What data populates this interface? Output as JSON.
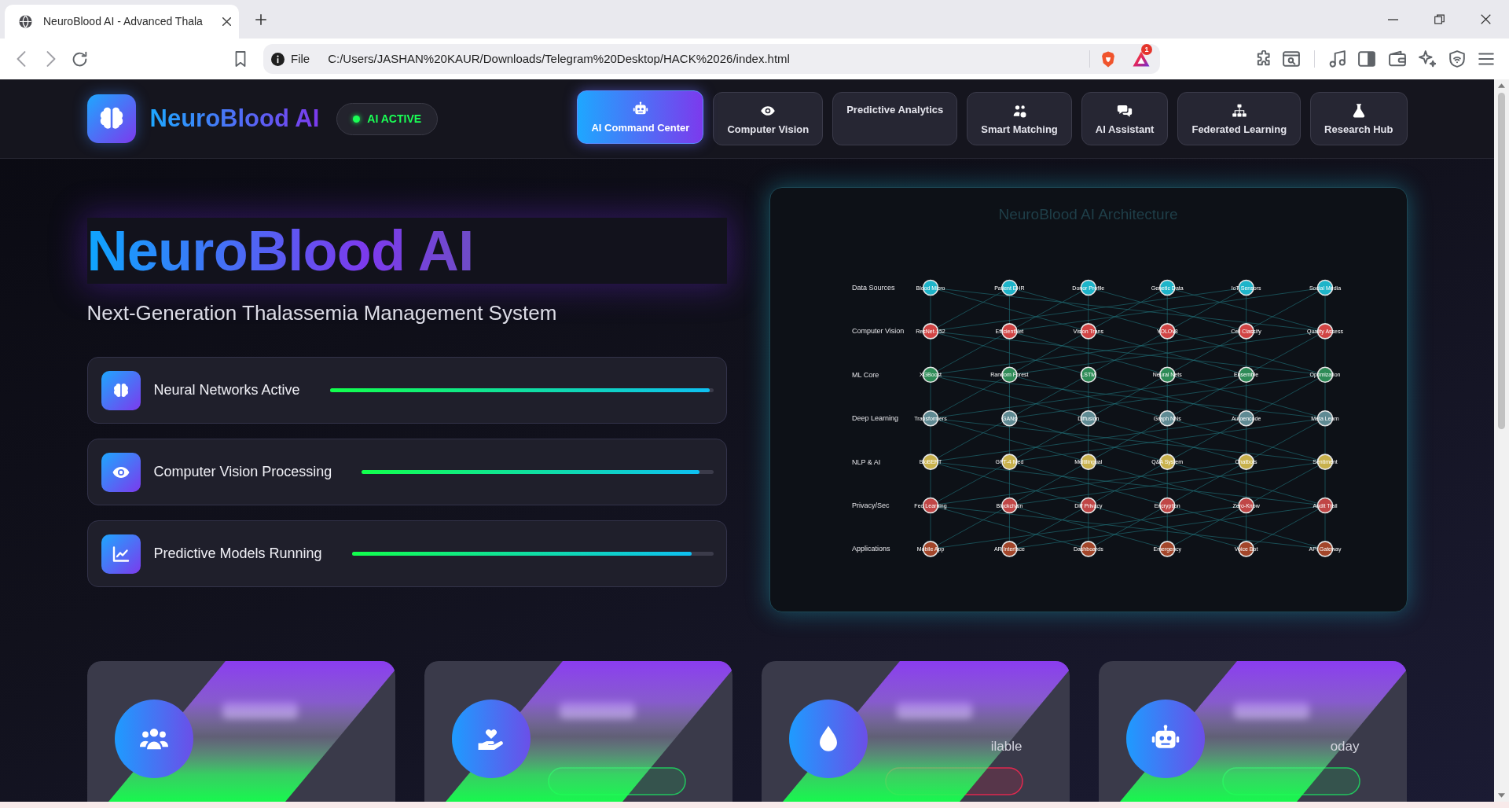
{
  "browser": {
    "tab_title": "NeuroBlood AI - Advanced Thala",
    "site_info": "File",
    "url": "C:/Users/JASHAN%20KAUR/Downloads/Telegram%20Desktop/HACK%2026/index.html",
    "rewards_badge": "1"
  },
  "header": {
    "brand": "NeuroBlood AI",
    "status": {
      "label": "AI ACTIVE",
      "on": true
    },
    "nav": [
      {
        "label": "AI Command Center",
        "kind": "icon_label",
        "selected": true
      },
      {
        "label": "Computer Vision",
        "kind": "icon_label",
        "selected": false
      },
      {
        "label": "Predictive Analytics",
        "kind": "label",
        "selected": false
      },
      {
        "label": "Smart Matching",
        "kind": "icon_label",
        "selected": false
      },
      {
        "label": "AI Assistant",
        "kind": "icon_label",
        "selected": false
      },
      {
        "label": "Federated Learning",
        "kind": "icon_label",
        "selected": false
      },
      {
        "label": "Research Hub",
        "kind": "icon_label",
        "selected": false
      }
    ]
  },
  "hero": {
    "title": "NeuroBlood AI",
    "subtitle": "Next-Generation Thalassemia Management System",
    "systems": [
      {
        "label": "Neural Networks Active",
        "level": 0.99
      },
      {
        "label": "Computer Vision Processing",
        "level": 0.96
      },
      {
        "label": "Predictive Models Running",
        "level": 0.94
      }
    ]
  },
  "architecture": {
    "title": "NeuroBlood AI Architecture",
    "layers": [
      {
        "label": "Data Sources",
        "color": "#1eb4c9",
        "nodes": [
          "Blood Micro",
          "Patient EHR",
          "Donor Profile",
          "Genetic Data",
          "IoT Sensors",
          "Social Media"
        ]
      },
      {
        "label": "Computer Vision",
        "color": "#d14444",
        "nodes": [
          "ResNet-152",
          "EfficientNet",
          "Vision Trans",
          "YOLOv8",
          "Cell Classify",
          "Quality Assess"
        ]
      },
      {
        "label": "ML Core",
        "color": "#2e8b57",
        "nodes": [
          "XGBoost",
          "Random Forest",
          "LSTM",
          "Neural Nets",
          "Ensemble",
          "Optimization"
        ]
      },
      {
        "label": "Deep Learning",
        "color": "#5f8a93",
        "nodes": [
          "Transformers",
          "GANs",
          "Diffusion",
          "Graph NNs",
          "Autoencode",
          "Meta Learn"
        ]
      },
      {
        "label": "NLP & AI",
        "color": "#c8b14c",
        "nodes": [
          "BioBERT",
          "GPT-4 Med",
          "Multilingual",
          "Q&A System",
          "Chatbots",
          "Sentiment"
        ]
      },
      {
        "label": "Privacy/Sec",
        "color": "#c04646",
        "nodes": [
          "Fed Learning",
          "Blockchain",
          "Diff Privacy",
          "Encryption",
          "Zero-Know",
          "Audit Trail"
        ]
      },
      {
        "label": "Applications",
        "color": "#a3462a",
        "nodes": [
          "Mobile App",
          "AR Interface",
          "Dashboards",
          "Emergency",
          "Voice Bot",
          "API Gateway"
        ]
      }
    ]
  },
  "stat_cards": [
    {
      "kind": "plain"
    },
    {
      "kind": "pill",
      "color": "#22c55e"
    },
    {
      "kind": "caption_pill",
      "caption": "ilable",
      "color": "#e0294f"
    },
    {
      "kind": "caption_pill",
      "caption": "oday",
      "color": "#22c55e"
    }
  ]
}
